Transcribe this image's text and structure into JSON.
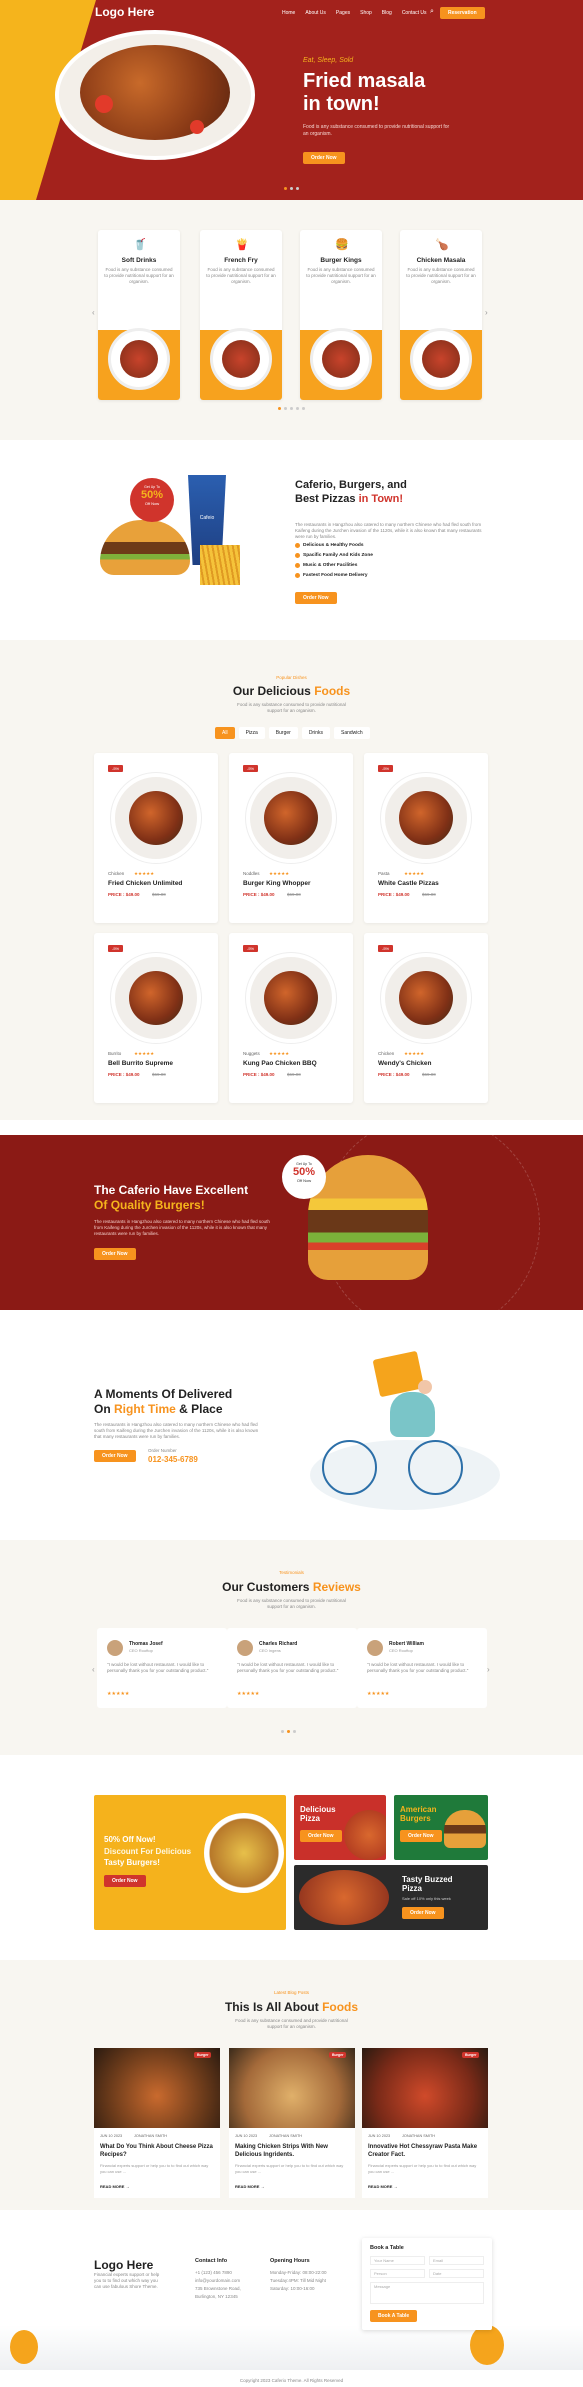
{
  "nav": {
    "logo": "Logo Here",
    "menu": [
      "Home",
      "About Us",
      "Pages",
      "Shop",
      "Blog",
      "Contact Us"
    ],
    "cta": "Reservation"
  },
  "hero": {
    "kicker": "Eat, Sleep, Sold",
    "title1": "Fried masala",
    "title2": "in town!",
    "desc": "Food is any substance consumed to provide nutritional support for an organism.",
    "button": "Order Now"
  },
  "categories": {
    "items": [
      {
        "title": "Soft Drinks",
        "desc": "Food is any substance consumed to provide nutritional support for an organism."
      },
      {
        "title": "French Fry",
        "desc": "Food is any substance consumed to provide nutritional support for an organism."
      },
      {
        "title": "Burger Kings",
        "desc": "Food is any substance consumed to provide nutritional support for an organism."
      },
      {
        "title": "Chicken Masala",
        "desc": "Food is any substance consumed to provide nutritional support for an organism."
      }
    ]
  },
  "promo": {
    "badge_top": "Get Up To",
    "badge_pct": "50%",
    "badge_off": "Off Now",
    "cup_label": "Cafeio",
    "title1": "Caferio, Burgers, and",
    "title2": "Best Pizzas",
    "title3": "in Town!",
    "desc": "The restaurants in Hangzhou also catered to many northern Chinese who had fled south from Kaifeng during the Jurchen invasion of the 1120s, while it is also known that many restaurants were run by families.",
    "features": [
      "Delicious & Healthy Foods",
      "Spacific Family And Kids Zone",
      "Music & Other Facilities",
      "Fastest Food Home Delivery"
    ],
    "button": "Order Now"
  },
  "menu": {
    "sub": "Popular Dishes",
    "title1": "Our Delicious",
    "title2": "Foods",
    "desc": "Food is any substance consumed to provide nutritional support for an organism.",
    "filters": [
      "All",
      "Pizza",
      "Burger",
      "Drinks",
      "Sandwich"
    ],
    "items": [
      {
        "tag": "-5%",
        "cat": "Chicken",
        "stars": "★★★★★",
        "name": "Fried Chicken Unlimited",
        "price": "PRICE : $49.00",
        "old": "$69.00"
      },
      {
        "tag": "-5%",
        "cat": "Noddles",
        "stars": "★★★★★",
        "name": "Burger King Whopper",
        "price": "PRICE : $49.00",
        "old": "$69.00"
      },
      {
        "tag": "-5%",
        "cat": "Pasta",
        "stars": "★★★★★",
        "name": "White Castle Pizzas",
        "price": "PRICE : $49.00",
        "old": "$69.00"
      },
      {
        "tag": "-5%",
        "cat": "Burrito",
        "stars": "★★★★★",
        "name": "Bell Burrito Supreme",
        "price": "PRICE : $49.00",
        "old": "$69.00"
      },
      {
        "tag": "-5%",
        "cat": "Nuggets",
        "stars": "★★★★★",
        "name": "Kung Pao Chicken BBQ",
        "price": "PRICE : $49.00",
        "old": "$69.00"
      },
      {
        "tag": "-5%",
        "cat": "Chicken",
        "stars": "★★★★★",
        "name": "Wendy's Chicken",
        "price": "PRICE : $49.00",
        "old": "$69.00"
      }
    ]
  },
  "banner": {
    "title1": "The Caferio Have Excellent",
    "title2": "Of",
    "title3": "Quality Burgers!",
    "desc": "The restaurants in Hangzhou also catered to many northern Chinese who had fled south from Kaifeng during the Jurchen invasion of the 1120s, while it is also known that many restaurants were run by families.",
    "button": "Order Now",
    "badge_top": "Get Up To",
    "badge_pct": "50%",
    "badge_off": "Off Now"
  },
  "delivery": {
    "title1": "A Moments Of Delivered",
    "title2": "On",
    "title3": "Right Time",
    "title4": "& Place",
    "desc": "The restaurants in Hangzhou also catered to many northern Chinese who had fled south from Kaifeng during the Jurchen invasion of the 1120s, while it is also known that many restaurants were run by families.",
    "button": "Order Now",
    "call": "Order Number",
    "number": "012-345-6789"
  },
  "reviews": {
    "sub": "Testimonials",
    "title1": "Our Customers",
    "title2": "Reviews",
    "desc": "Food is any substance consumed to provide nutritional support for an organism.",
    "items": [
      {
        "name": "Thomas Josef",
        "role": "CEO Rooftop",
        "text": "\"I would be lost without restaurant. I would like to personally thank you for your outstanding product.\"",
        "stars": "★★★★★"
      },
      {
        "name": "Charles Richard",
        "role": "CEO Ingens",
        "text": "\"I would be lost without restaurant. I would like to personally thank you for your outstanding product.\"",
        "stars": "★★★★★"
      },
      {
        "name": "Robert William",
        "role": "CEO Rooftop",
        "text": "\"I would be lost without restaurant. I would like to personally thank you for your outstanding product.\"",
        "stars": "★★★★★"
      }
    ]
  },
  "offers": {
    "big1": "50% Off Now!",
    "big2": "Discount For Delicious",
    "big3": "Tasty Burgers!",
    "big_btn": "Order Now",
    "pizza": "Delicious Pizza",
    "pizza_btn": "Order Now",
    "burger": "American Burgers",
    "burger_btn": "Order Now",
    "buzzed1": "Tasty Buzzed",
    "buzzed2": "Pizza",
    "buzzed3": "Sale off 10% only this week",
    "buzzed_btn": "Order Now"
  },
  "blog": {
    "sub": "Latest Blog Posts",
    "title1": "This Is All About",
    "title2": "Foods",
    "desc": "Food is any substance consumed and provide nutritional support for an organism.",
    "items": [
      {
        "tag": "Burger",
        "date": "JUN 10 2023",
        "author": "JONATHAN SMITH",
        "title": "What Do You Think About Cheese Pizza Recipes?",
        "excerpt": "Financial experts support or help you to to find out which way you can use ...",
        "more": "READ MORE"
      },
      {
        "tag": "Burger",
        "date": "JUN 10 2023",
        "author": "JONATHAN SMITH",
        "title": "Making Chicken Strips With New Delicious Ingridents.",
        "excerpt": "Financial experts support or help you to to find out which way you can use ...",
        "more": "READ MORE"
      },
      {
        "tag": "Burger",
        "date": "JUN 10 2023",
        "author": "JONATHAN SMITH",
        "title": "Innovative Hot Chessyraw Pasta Make Creator Fact.",
        "excerpt": "Financial experts support or help you to to find out which way you can use ...",
        "more": "READ MORE"
      }
    ]
  },
  "footer": {
    "logo": "Logo Here",
    "desc": "Financial experts support or help you to to find out which way you can use fabulous Shore Theme.",
    "contact_title": "Contact Info",
    "contact": [
      "+1 (123) 456 7890",
      "info@yourdomain.com",
      "735 Brownstone Road, Burlington, NY 12345"
    ],
    "hours_title": "Opening Hours",
    "hours": [
      "Monday-Friday: 08:00-22:00",
      "Tuesday:4PM: Till Mid Night",
      "Saturday: 10:00-16:00"
    ],
    "form_title": "Book a Table",
    "form_fields": [
      "Your Name",
      "Email",
      "Person",
      "Date",
      "Message"
    ],
    "form_btn": "Book A Table",
    "copyright": "Copyright 2023 Caferio Theme. All Rights Reserved"
  }
}
